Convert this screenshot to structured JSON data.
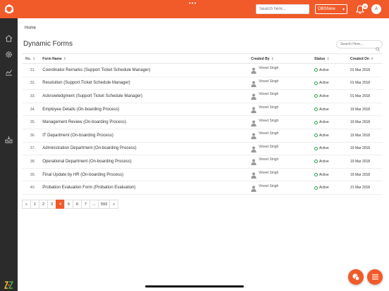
{
  "header": {
    "search_placeholder": "Search here...",
    "company_select": "OBSNew",
    "notification_count": "00",
    "avatar_letter": "A"
  },
  "breadcrumb": "Home",
  "page_title": "Dynamic Forms",
  "table_search_placeholder": "Search Here...",
  "columns": [
    "No.",
    "Form Name",
    "Created By",
    "Status",
    "Created On"
  ],
  "rows": [
    {
      "no": "31.",
      "name": "Coordinator Remarks (Support Ticket Schedule Manager)",
      "by": "Vineet Singh",
      "status": "Active",
      "date": "01 Mar 2018"
    },
    {
      "no": "32.",
      "name": "Resolution (Support Ticket Schedule Manager)",
      "by": "Vineet Singh",
      "status": "Active",
      "date": "01 Mar 2018"
    },
    {
      "no": "33.",
      "name": "Acknowledgment (Support Ticket Schedule Manager)",
      "by": "Vineet Singh",
      "status": "Active",
      "date": "01 Mar 2018"
    },
    {
      "no": "34.",
      "name": "Employee Details (On-boarding Process)",
      "by": "Vineet Singh",
      "status": "Active",
      "date": "19 Mar 2018"
    },
    {
      "no": "35.",
      "name": "Management Review (On-boarding Process)",
      "by": "Vineet Singh",
      "status": "Active",
      "date": "19 Mar 2018"
    },
    {
      "no": "36.",
      "name": "IT Department (On-boarding Process)",
      "by": "Vineet Singh",
      "status": "Active",
      "date": "19 Mar 2018"
    },
    {
      "no": "37.",
      "name": "Administration Department (On-boarding Process)",
      "by": "Vineet Singh",
      "status": "Active",
      "date": "19 Mar 2018"
    },
    {
      "no": "38.",
      "name": "Operational Department (On-boarding Process)",
      "by": "Vineet Singh",
      "status": "Active",
      "date": "19 Mar 2018"
    },
    {
      "no": "39.",
      "name": "Final Update by HR (On-boarding Process)",
      "by": "Vineet Singh",
      "status": "Active",
      "date": "19 Mar 2018"
    },
    {
      "no": "40.",
      "name": "Probation Evaluation Form (Probation Evaluation)",
      "by": "Vineet Singh",
      "status": "Active",
      "date": "21 Mar 2018"
    }
  ],
  "pagination": [
    "«",
    "1",
    "2",
    "3",
    "4",
    "5",
    "6",
    "7",
    "...",
    "593",
    "»"
  ],
  "pagination_active": "4",
  "colors": {
    "accent": "#f15a29",
    "sidebar": "#2b2b2b",
    "active_status": "#2ea043"
  }
}
